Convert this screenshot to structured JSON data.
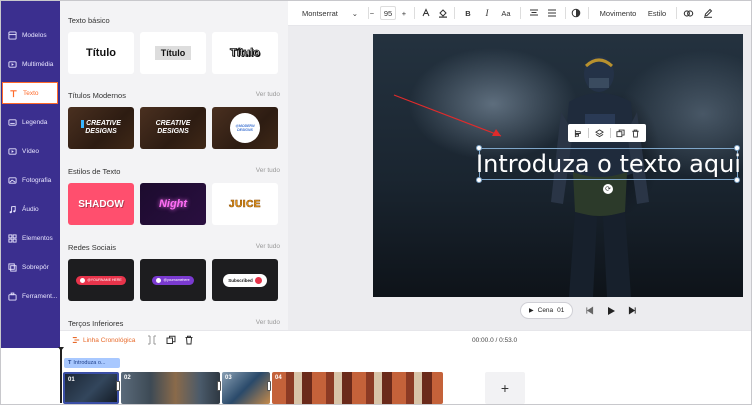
{
  "sidebar": {
    "items": [
      {
        "label": "Modelos",
        "icon": "templates-icon"
      },
      {
        "label": "Multimédia",
        "icon": "media-icon"
      },
      {
        "label": "Texto",
        "icon": "text-icon",
        "active": true
      },
      {
        "label": "Legenda",
        "icon": "subtitle-icon"
      },
      {
        "label": "Vídeo",
        "icon": "video-icon"
      },
      {
        "label": "Fotografia",
        "icon": "photo-icon"
      },
      {
        "label": "Áudio",
        "icon": "audio-icon"
      },
      {
        "label": "Elementos",
        "icon": "elements-icon"
      },
      {
        "label": "Sobrepôr",
        "icon": "overlay-icon"
      },
      {
        "label": "Ferrament...",
        "icon": "tools-icon"
      }
    ]
  },
  "library": {
    "sections": [
      {
        "title": "Texto básico",
        "more": ""
      },
      {
        "title": "Títulos Modernos",
        "more": "Ver tudo"
      },
      {
        "title": "Estilos de Texto",
        "more": "Ver tudo"
      },
      {
        "title": "Redes Sociais",
        "more": "Ver tudo"
      },
      {
        "title": "Terços Inferiores",
        "more": "Ver tudo"
      }
    ],
    "basic_tiles": [
      "Título",
      "Título",
      "Título"
    ],
    "modern_tiles": [
      {
        "line1": "CREATIVE",
        "line2": "DESIGNS"
      },
      {
        "line1": "CREATIVE",
        "line2": "DESIGNS"
      },
      {
        "line1": "@MODERN",
        "line2": "DESIGNS"
      }
    ],
    "style_tiles": [
      "SHADOW",
      "Night",
      "JUICE"
    ],
    "social_tiles": [
      "@YOURNAME HERE",
      "@yournamehere",
      "Subscribed"
    ]
  },
  "toolbar": {
    "font": "Montserrat",
    "size": "95",
    "minus": "−",
    "plus": "+",
    "bold": "B",
    "italic": "I",
    "case": "Aa",
    "movement": "Movimento",
    "style": "Estilo"
  },
  "canvas": {
    "text": "Introduza o texto aqui",
    "accent_arrow_color": "#e02b2b"
  },
  "playback": {
    "scene_label": "Cena",
    "scene_number": "01"
  },
  "timeline": {
    "timeline_label": "Linha Cronológica",
    "timecode": "00:00.0 / 0:53.0",
    "text_track_label": "Introduza o...",
    "clips": [
      "01",
      "02",
      "03",
      "04"
    ],
    "add": "+"
  },
  "colors": {
    "rail": "#3b2f8f",
    "active": "#ff6a2a",
    "selection": "#3a4ea5"
  }
}
